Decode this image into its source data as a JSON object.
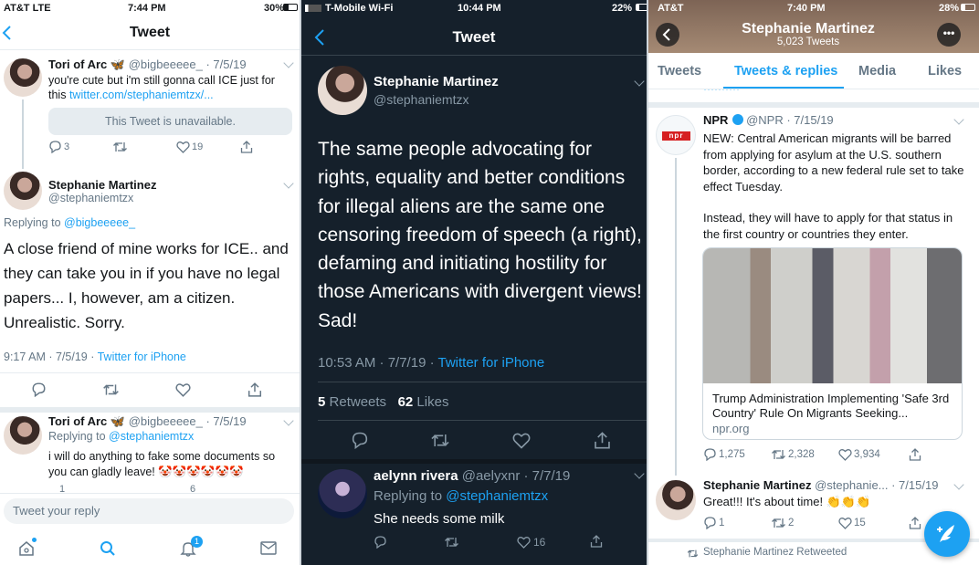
{
  "panel1": {
    "status": {
      "carrier": "AT&T  LTE",
      "time": "7:44 PM",
      "battery": "30%"
    },
    "header": {
      "title": "Tweet"
    },
    "tweet1": {
      "name": "Tori of Arc 🦋",
      "handle": "@bigbeeeee_ · 7/5/19",
      "text": "you're cute but i'm still gonna call ICE just for this",
      "link": "twitter.com/stephaniemtzx/...",
      "unavailable": "This Tweet is unavailable.",
      "replies": "3",
      "likes": "19"
    },
    "main": {
      "name": "Stephanie Martinez",
      "handle": "@stephaniemtzx",
      "replying_prefix": "Replying to ",
      "replying_to": "@bigbeeeee_",
      "text": "A close friend of mine works for ICE.. and they can take you in if you have no legal papers... I, however, am a citizen. Unrealistic. Sorry.",
      "time": "9:17 AM · 7/5/19 · ",
      "source": "Twitter for iPhone"
    },
    "tweet3": {
      "name": "Tori of Arc 🦋",
      "handle": "@bigbeeeee_ · 7/5/19",
      "replying_prefix": "Replying to ",
      "replying_to": "@stephaniemtzx",
      "text": "i will do anything to fake some documents so you can gladly leave! 🤡🤡🤡🤡🤡🤡",
      "replies": "1",
      "likes": "6"
    },
    "reply_placeholder": "Tweet your reply",
    "tabbar": {
      "notif_count": "1"
    }
  },
  "panel2": {
    "status": {
      "carrier": "T-Mobile Wi-Fi",
      "time": "10:44 PM",
      "battery": "22%"
    },
    "header": {
      "title": "Tweet"
    },
    "main": {
      "name": "Stephanie Martinez",
      "handle": "@stephaniemtzx",
      "text": "The same people advocating for rights, equality and better conditions for illegal aliens are the same one censoring freedom of speech (a right), defaming and initiating hostility for those Americans with divergent views! Sad!",
      "time": "10:53 AM · 7/7/19 · ",
      "source": "Twitter for iPhone",
      "retweets_count": "5",
      "retweets_label": "Retweets",
      "likes_count": "62",
      "likes_label": "Likes"
    },
    "reply": {
      "name": "aelynn rivera",
      "handle": "@aelyxnr · 7/7/19",
      "replying_prefix": "Replying to ",
      "replying_to": "@stephaniemtzx",
      "text": "She needs some milk",
      "likes": "16"
    }
  },
  "panel3": {
    "status": {
      "carrier": "AT&T",
      "time": "7:40 PM",
      "battery": "28%"
    },
    "header": {
      "name": "Stephanie Martinez",
      "count": "5,023 Tweets"
    },
    "tabs": [
      "Tweets",
      "Tweets & replies",
      "Media",
      "Likes"
    ],
    "npr": {
      "name": "NPR",
      "handle": "@NPR · 7/15/19",
      "logo": "npr",
      "text1": "NEW: Central American migrants will be barred from applying for asylum at the U.S. southern border, according to a new federal rule set to take effect Tuesday.",
      "text2": "Instead, they will have to apply for that status in the first country or countries they enter.",
      "card_title": "Trump Administration Implementing 'Safe 3rd Country' Rule On Migrants Seeking...",
      "card_domain": "npr.org",
      "replies": "1,275",
      "retweets": "2,328",
      "likes": "3,934"
    },
    "reply": {
      "name": "Stephanie Martinez",
      "handle": "@stephanie... · 7/15/19",
      "text": "Great!!! It's about time! 👏👏👏",
      "replies": "1",
      "retweets": "2",
      "likes": "15"
    },
    "retweeted": "Stephanie Martinez Retweeted"
  }
}
